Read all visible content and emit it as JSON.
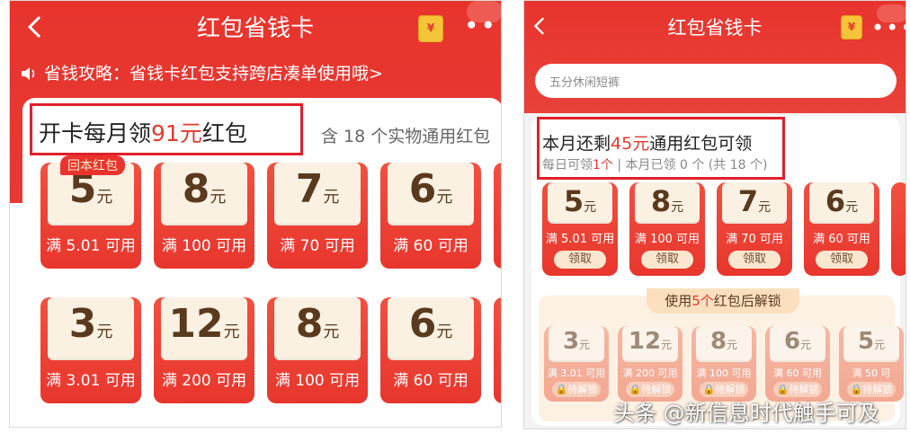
{
  "left": {
    "title": "红包省钱卡",
    "notice": "省钱攻略：省钱卡红包支持跨店凑单使用哦>",
    "headline_prefix": "开卡每月领",
    "headline_amount": "91元",
    "headline_suffix": "红包",
    "sub_note": "含 18 个实物通用红包",
    "ribbon": "回本红包",
    "coupons": [
      {
        "amount": "5",
        "unit": "元",
        "condition": "满 5.01 可用"
      },
      {
        "amount": "8",
        "unit": "元",
        "condition": "满 100 可用"
      },
      {
        "amount": "7",
        "unit": "元",
        "condition": "满 70 可用"
      },
      {
        "amount": "6",
        "unit": "元",
        "condition": "满 60 可用"
      },
      {
        "amount": "3",
        "unit": "元",
        "condition": "满 3.01 可用"
      },
      {
        "amount": "12",
        "unit": "元",
        "condition": "满 200 可用"
      },
      {
        "amount": "8",
        "unit": "元",
        "condition": "满 100 可用"
      },
      {
        "amount": "6",
        "unit": "元",
        "condition": "满 60 可用"
      }
    ]
  },
  "right": {
    "title": "红包省钱卡",
    "search_placeholder": "五分休闲短裤",
    "headline_prefix": "本月还剩",
    "headline_amount": "45元",
    "headline_suffix": "通用红包可领",
    "sub_prefix": "每日可领",
    "sub_count": "1个",
    "sub_suffix": " | 本月已领 0 个 (共 18 个)",
    "claim_label": "领取",
    "unlock_prefix": "使用",
    "unlock_count": "5个",
    "unlock_suffix": "红包后解锁",
    "locked_label": "待解锁",
    "coupons": [
      {
        "amount": "5",
        "unit": "元",
        "condition": "满 5.01 可用"
      },
      {
        "amount": "8",
        "unit": "元",
        "condition": "满 100 可用"
      },
      {
        "amount": "7",
        "unit": "元",
        "condition": "满 70 可用"
      },
      {
        "amount": "6",
        "unit": "元",
        "condition": "满 60 可用"
      }
    ],
    "locked_coupons": [
      {
        "amount": "3",
        "unit": "元",
        "condition": "满 3.01 可用"
      },
      {
        "amount": "12",
        "unit": "元",
        "condition": "满 200 可用"
      },
      {
        "amount": "8",
        "unit": "元",
        "condition": "满 100 可用"
      },
      {
        "amount": "6",
        "unit": "元",
        "condition": "满 60 可用"
      },
      {
        "amount": "5",
        "unit": "元",
        "condition": "满 50 可"
      }
    ]
  },
  "watermark": "头条 @新信息时代触手可及",
  "colors": {
    "brand_red": "#e8342d",
    "highlight_box": "#e0202a",
    "amount_brown": "#5a3a1e",
    "coupon_paper": "#fbf1e3"
  },
  "icons": [
    "back-icon",
    "coin-icon",
    "more-icon",
    "speaker-icon",
    "lock-icon"
  ]
}
